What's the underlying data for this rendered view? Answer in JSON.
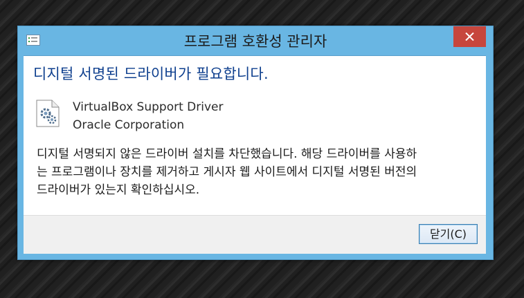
{
  "window": {
    "title": "프로그램 호환성 관리자",
    "close_icon": "close-icon",
    "app_icon": "program-compatibility-icon"
  },
  "content": {
    "main_instruction": "디지털 서명된 드라이버가 필요합니다.",
    "driver": {
      "icon": "driver-gear-file-icon",
      "name": "VirtualBox Support Driver",
      "publisher": "Oracle Corporation"
    },
    "message_lines": [
      "디지털 서명되지 않은 드라이버 설치를 차단했습니다. 해당 드라이버를 사용하",
      "는 프로그램이나 장치를 제거하고 게시자 웹 사이트에서 디지털 서명된 버전의",
      "드라이버가 있는지 확인하십시오."
    ]
  },
  "footer": {
    "close_button_label": "닫기(C)"
  },
  "colors": {
    "window_frame": "#69b6e3",
    "close_button": "#c7463d",
    "main_instruction_text": "#0e3f8e"
  }
}
